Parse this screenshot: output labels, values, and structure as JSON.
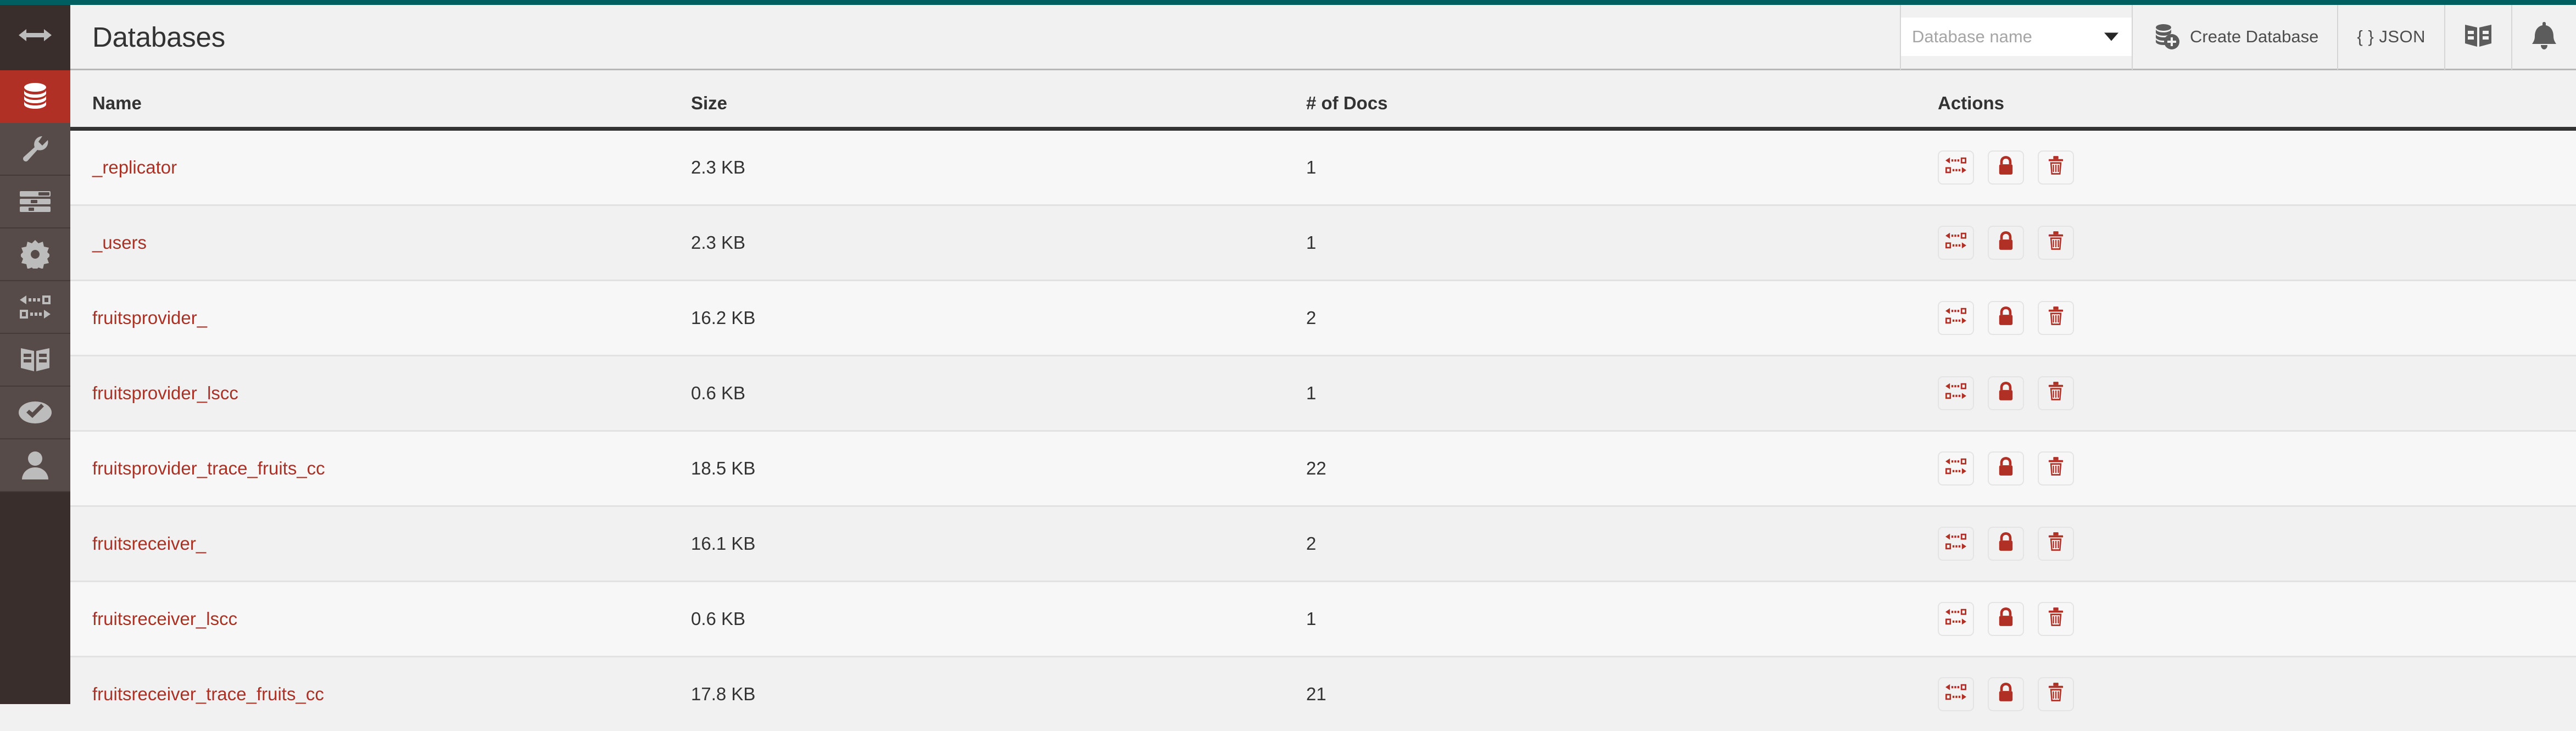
{
  "app": {
    "accent_color": "#005f61",
    "brand_red": "#b13026",
    "link_red": "#a93226",
    "sidebar_bg": "#3a2e2c",
    "sidebar_item_bg": "#574b49"
  },
  "sidebar": {
    "items": [
      {
        "name": "toggle-sidebar",
        "icon": "arrows-horizontal-icon",
        "active": false
      },
      {
        "name": "databases",
        "icon": "database-icon",
        "active": true
      },
      {
        "name": "setup",
        "icon": "wrench-icon",
        "active": false
      },
      {
        "name": "active-tasks",
        "icon": "list-icon",
        "active": false
      },
      {
        "name": "configuration",
        "icon": "gear-icon",
        "active": false
      },
      {
        "name": "replication",
        "icon": "replication-arrows-icon",
        "active": false
      },
      {
        "name": "documentation",
        "icon": "book-icon",
        "active": false
      },
      {
        "name": "verify",
        "icon": "check-circle-icon",
        "active": false
      },
      {
        "name": "account",
        "icon": "user-icon",
        "active": false
      }
    ]
  },
  "header": {
    "title": "Databases",
    "db_search": {
      "placeholder": "Database name",
      "value": ""
    },
    "create_database_label": "Create Database",
    "json_label": "{ } JSON",
    "docs_icon": "book-icon",
    "notifications_icon": "bell-icon"
  },
  "table": {
    "columns": [
      "Name",
      "Size",
      "# of Docs",
      "Actions"
    ],
    "row_actions": [
      "replicate-icon",
      "permissions-lock-icon",
      "delete-trash-icon"
    ],
    "rows": [
      {
        "name": "_replicator",
        "size": "2.3 KB",
        "docs": "1"
      },
      {
        "name": "_users",
        "size": "2.3 KB",
        "docs": "1"
      },
      {
        "name": "fruitsprovider_",
        "size": "16.2 KB",
        "docs": "2"
      },
      {
        "name": "fruitsprovider_lscc",
        "size": "0.6 KB",
        "docs": "1"
      },
      {
        "name": "fruitsprovider_trace_fruits_cc",
        "size": "18.5 KB",
        "docs": "22"
      },
      {
        "name": "fruitsreceiver_",
        "size": "16.1 KB",
        "docs": "2"
      },
      {
        "name": "fruitsreceiver_lscc",
        "size": "0.6 KB",
        "docs": "1"
      },
      {
        "name": "fruitsreceiver_trace_fruits_cc",
        "size": "17.8 KB",
        "docs": "21"
      }
    ]
  }
}
